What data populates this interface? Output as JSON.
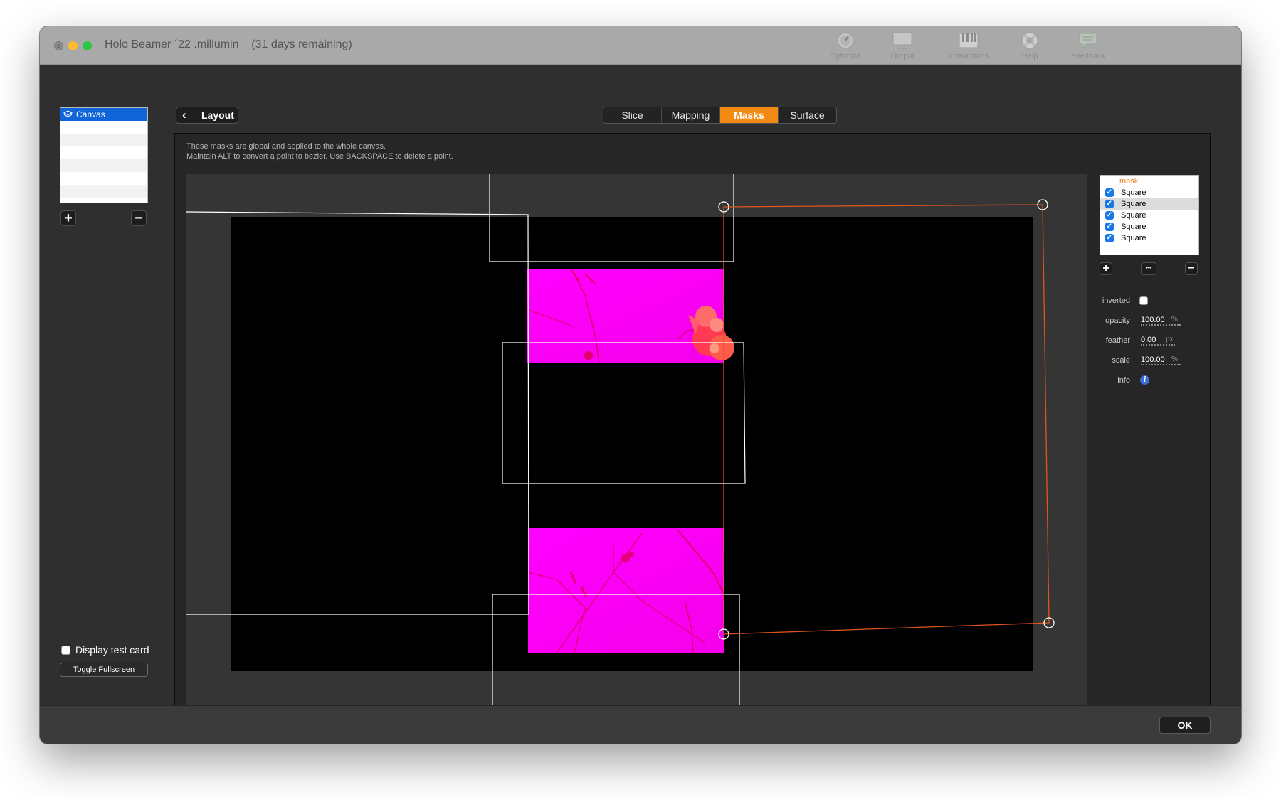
{
  "window": {
    "title": "Holo Beamer ´22 .millumin    (31 days remaining)"
  },
  "toolbar": {
    "items": [
      {
        "label": "Optimize",
        "icon": "optimize-icon"
      },
      {
        "label": "Output",
        "icon": "monitor-icon"
      },
      {
        "label": "Interactions",
        "icon": "piano-icon"
      },
      {
        "label": "Help",
        "icon": "lifebuoy-icon"
      },
      {
        "label": "Feedback",
        "icon": "speech-bubble-icon"
      }
    ]
  },
  "sidebar": {
    "canvas_label": "Canvas",
    "add_symbol": "+",
    "remove_symbol": "−",
    "display_test_card_label": "Display test card",
    "toggle_fullscreen_label": "Toggle Fullscreen"
  },
  "header": {
    "back_label": "Layout",
    "tabs": [
      {
        "label": "Slice",
        "active": false
      },
      {
        "label": "Mapping",
        "active": false
      },
      {
        "label": "Masks",
        "active": true
      },
      {
        "label": "Surface",
        "active": false
      }
    ]
  },
  "instructions": {
    "line1": "These masks are global and applied to the whole canvas.",
    "line2": "Maintain ALT to convert a point to bezier. Use BACKSPACE to delete a point."
  },
  "masks": {
    "header": "mask",
    "items": [
      {
        "label": "Square",
        "checked": true,
        "selected": false
      },
      {
        "label": "Square",
        "checked": true,
        "selected": true
      },
      {
        "label": "Square",
        "checked": true,
        "selected": false
      },
      {
        "label": "Square",
        "checked": true,
        "selected": false
      },
      {
        "label": "Square",
        "checked": true,
        "selected": false
      }
    ],
    "more_symbol": "•••"
  },
  "properties": {
    "inverted_label": "inverted",
    "inverted": false,
    "opacity_label": "opacity",
    "opacity_value": "100.00",
    "opacity_unit": "%",
    "feather_label": "feather",
    "feather_value": "0.00",
    "feather_unit": "px",
    "scale_label": "scale",
    "scale_value": "100.00",
    "scale_unit": "%",
    "info_label": "info",
    "info_symbol": "i"
  },
  "footer": {
    "ok_label": "OK"
  },
  "colors": {
    "accent": "#f28a14",
    "selection": "#1065d8",
    "mask_outline": "#e0551b",
    "content_magenta": "#ff00ff"
  }
}
